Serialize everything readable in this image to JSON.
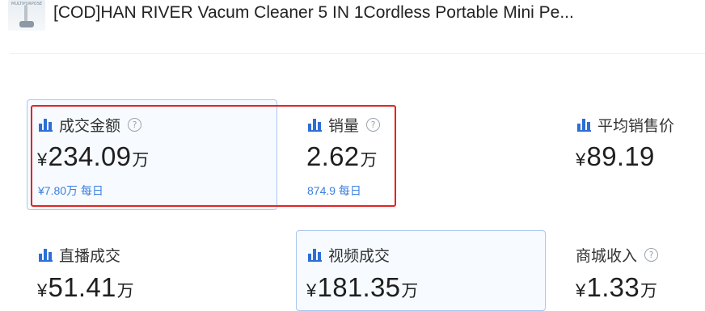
{
  "header": {
    "thumbnail_text": "MULTIPURPOSE",
    "product_title": "[COD]HAN RIVER Vacum Cleaner 5 IN 1Cordless Portable Mini Pe..."
  },
  "metrics": {
    "gmv": {
      "label": "成交金额",
      "currency": "¥",
      "value": "234.09",
      "unit": "万",
      "sub": "¥7.80万 每日",
      "icon": "bar-chart-icon",
      "has_help": true
    },
    "sales": {
      "label": "销量",
      "value": "2.62",
      "unit": "万",
      "sub": "874.9 每日",
      "icon": "bar-chart-icon",
      "has_help": true
    },
    "avg_price": {
      "label": "平均销售价",
      "currency": "¥",
      "value": "89.19",
      "icon": "bar-chart-icon"
    },
    "live": {
      "label": "直播成交",
      "currency": "¥",
      "value": "51.41",
      "unit": "万",
      "icon": "bar-chart-icon"
    },
    "video": {
      "label": "视频成交",
      "currency": "¥",
      "value": "181.35",
      "unit": "万",
      "icon": "bar-chart-icon"
    },
    "mall": {
      "label": "商城收入",
      "currency": "¥",
      "value": "1.33",
      "unit": "万",
      "has_help": true
    }
  },
  "colors": {
    "accent": "#2d6fd6",
    "sub_text": "#3a7fe0",
    "highlight_border": "#e32424",
    "selected_card_border": "#a9c6ef"
  }
}
